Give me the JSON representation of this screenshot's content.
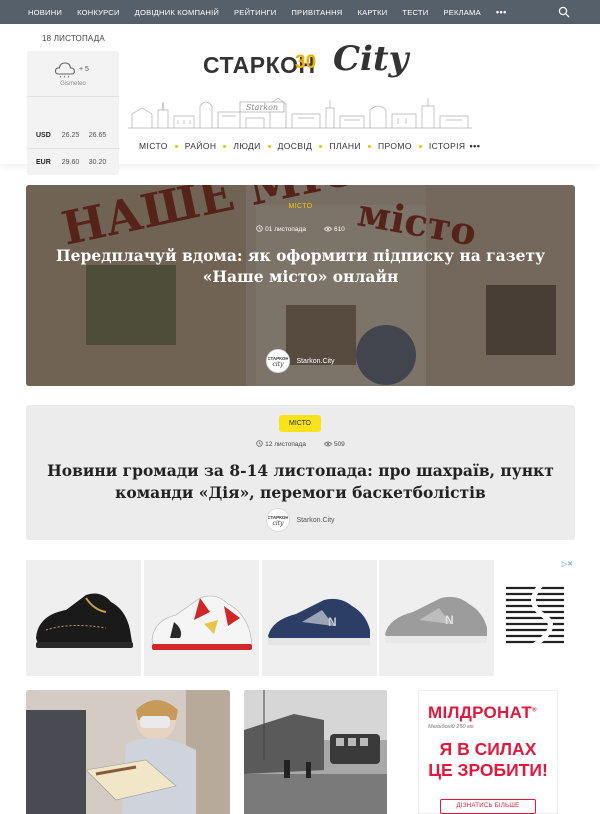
{
  "topnav": {
    "items": [
      "НОВИНИ",
      "КОНКУРСИ",
      "ДОВІДНИК КОМПАНІЙ",
      "РЕЙТИНГИ",
      "ПРИВІТАННЯ",
      "КАРТКИ",
      "ТЕСТИ",
      "РЕКЛАМА"
    ],
    "more": "•••",
    "search_icon": "search-icon"
  },
  "header": {
    "date": "18 ЛИСТОПАДА",
    "weather": {
      "temp": "+ 5",
      "source": "Gismeteo",
      "icon": "cloud-icon"
    },
    "rates": [
      {
        "currency": "USD",
        "buy": "26.25",
        "sell": "26.65"
      },
      {
        "currency": "EUR",
        "buy": "29.60",
        "sell": "30.20"
      }
    ],
    "logo": {
      "word": "СТАРКОН",
      "num": "30",
      "city": "City"
    }
  },
  "secnav": {
    "items": [
      "МІСТО",
      "РАЙОН",
      "ЛЮДИ",
      "ДОСВІД",
      "ПЛАНИ",
      "ПРОМО",
      "ІСТОРІЯ"
    ],
    "more": "•••"
  },
  "articles": [
    {
      "category": "МІСТО",
      "date": "01 листопада",
      "views": "610",
      "title": "Передплачуй вдома: як оформити підписку на газету «Наше місто» онлайн",
      "author": "Starkon.City"
    },
    {
      "category": "МІСТО",
      "date": "12 листопада",
      "views": "509",
      "title": "Новини громади за 8-14 листопада: про шахраїв, пункт команди «Дія», перемоги баскетболістів",
      "author": "Starkon.City"
    }
  ],
  "ad": {
    "close": "▷✕",
    "mild": {
      "brand": "МІЛДРОНАТ",
      "reg": "®",
      "dose": "Мельдоній 250 мг",
      "slogan_1": "Я В СИЛАХ",
      "slogan_2": "ЦЕ ЗРОБИТИ!",
      "button": "ДІЗНАТИСЬ БІЛЬШЕ"
    }
  },
  "colors": {
    "accent": "#f2c500",
    "nav": "#55606a",
    "pill": "#f7e21c",
    "ad_red": "#e4183a"
  }
}
